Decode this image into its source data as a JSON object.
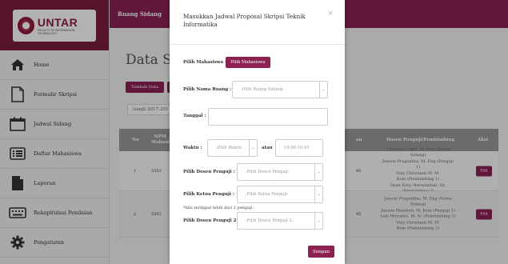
{
  "logo": {
    "name": "UNTAR",
    "sub": "FACULTY OF INFORMATION TECHNOLOGY"
  },
  "sidebar": {
    "items": [
      {
        "label": "Home",
        "icon": "home-icon"
      },
      {
        "label": "Formulir Skripsi",
        "icon": "document-icon"
      },
      {
        "label": "Jadwal Sidang",
        "icon": "calendar-icon"
      },
      {
        "label": "Daftar Mahasiswa",
        "icon": "list-icon"
      },
      {
        "label": "Laporan",
        "icon": "report-icon"
      },
      {
        "label": "Rekapitulasi Penilaian",
        "icon": "keyboard-icon"
      },
      {
        "label": "Pengaturan",
        "icon": "gear-icon"
      }
    ]
  },
  "topbar": {
    "title": "Ruang Sidang"
  },
  "main": {
    "title": "Data Sida",
    "add_label": "Tambah Data",
    "term_label": "Ganjil 2017-201",
    "table": {
      "headers": {
        "no": "No",
        "npm": "NPM",
        "npm2": "Mahasi",
        "dosen": "Dosen Penguji/Pembimbing",
        "aksi": "Aksi",
        "time": "an"
      },
      "rows": [
        {
          "no": "1",
          "npm": "5351",
          "time": "45",
          "dosen": [
            "Chairisni Lubis, M. Kom (Ketua Sidang)",
            "Janson Pragantha, M. Eng (Penguji 1)",
            "Viny Christanti M. M.",
            "Kom (Pembimbing 1)",
            "Dyah Erny Herwindiati, Dr. (Pembimbing 2)"
          ],
          "edit": "Edit"
        },
        {
          "no": "2",
          "npm": "5351",
          "time": "45",
          "dosen": [
            "Janson Pragantha, M. Eng (Ketua",
            "Sidang)",
            "Janson Hendryli, M. Kom (Penguji 1)",
            "Lely Hiryanto, M. Sc (Pembimbing 1)",
            "Viny Christanti M. M.",
            "Kom (Pembimbing 2)"
          ],
          "edit": "Edit"
        }
      ]
    }
  },
  "modal": {
    "title": "Masukkan Jadwal Proposal Skripsi Teknik Informatika",
    "close": "×",
    "pilih_mahasiswa_label": "Pilih Mahasiswa :",
    "pilih_mahasiswa_button": "Pilih Mahasiswa",
    "ruang_label": "Pilih Nama Ruang :",
    "ruang_placeholder": "-Pilih Ruang Sidang-",
    "tanggal_label": "Tanggal :",
    "tanggal_value": "",
    "waktu_label": "Waktu :",
    "waktu_placeholder": "-Pilih Waktu-",
    "atau_label": "atau",
    "waktu_manual_placeholder": "10:00-10:45",
    "dosen_penguji_label": "Pilih Dosen Penguji :",
    "dosen_penguji_placeholder": "-Pilih Dosen Penguji-",
    "ketua_penguji_label": "Pilih Ketua Penguji :",
    "ketua_penguji_placeholder": "-Pilih Ketua Penguji-",
    "note": "*bila terdapat lebih dari 1 penguji :",
    "dosen_penguji2_label": "Pilih Dosen Penguji 2 :",
    "dosen_penguji2_placeholder": "-Pilih Dosen Penguji 2-",
    "save_label": "Simpan"
  },
  "colors": {
    "primary": "#8b2252",
    "logo_bg": "#7a1c3f",
    "overlay": "rgba(0,0,0,0.30)"
  }
}
